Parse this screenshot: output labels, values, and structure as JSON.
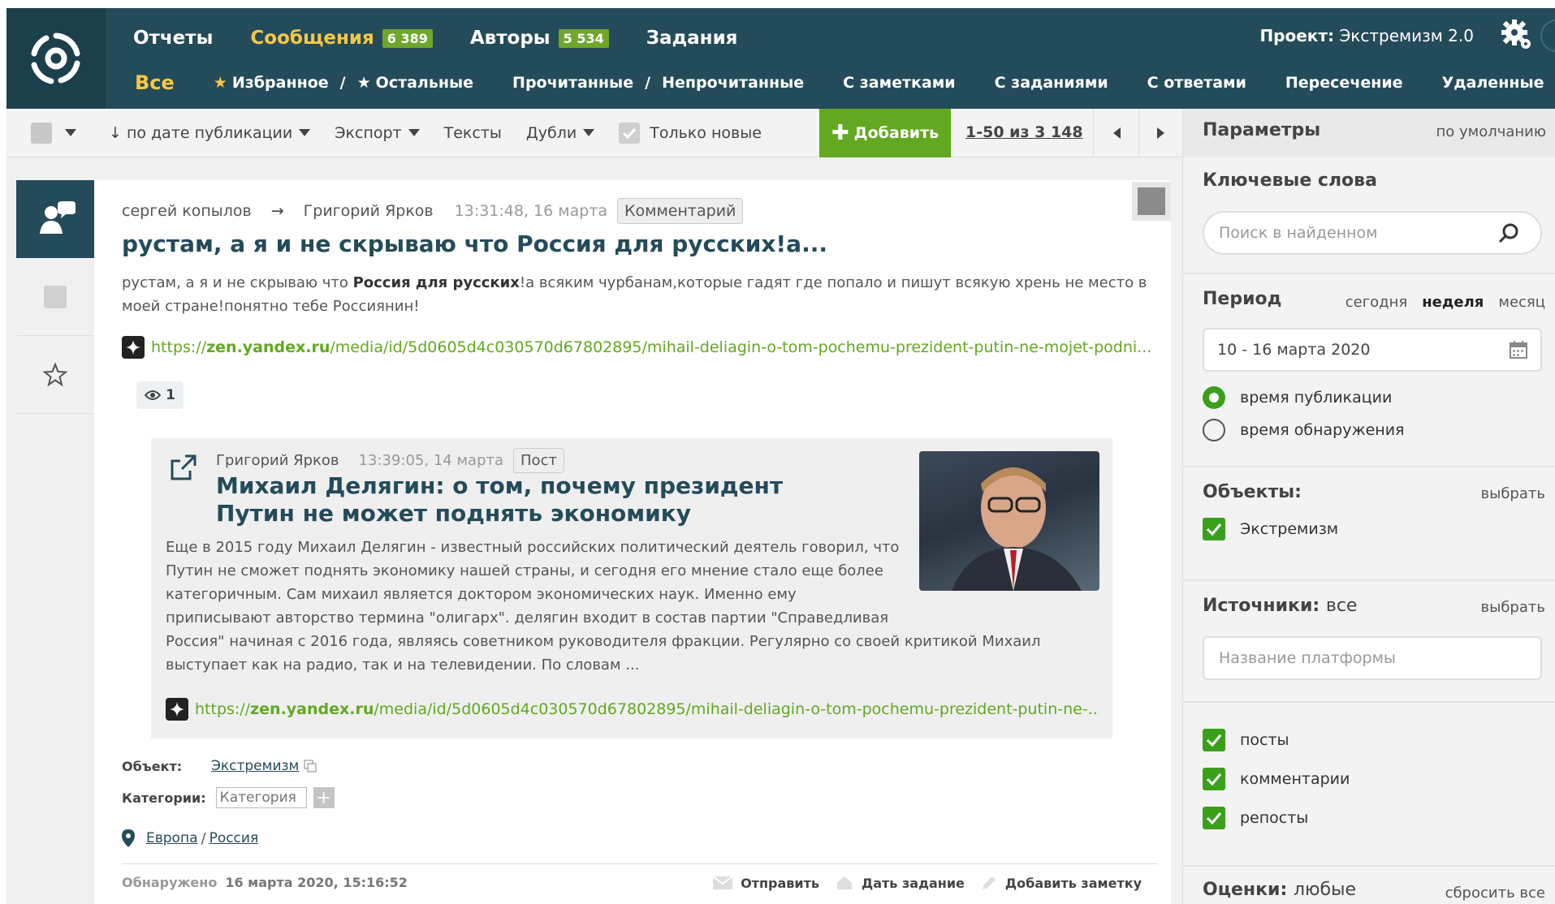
{
  "header": {
    "nav": [
      {
        "label": "Отчеты",
        "badge": null,
        "active": false
      },
      {
        "label": "Сообщения",
        "badge": "6 389",
        "active": true
      },
      {
        "label": "Авторы",
        "badge": "5 534",
        "active": false
      },
      {
        "label": "Задания",
        "badge": null,
        "active": false
      }
    ],
    "project_label": "Проект:",
    "project_name": "Экстремизм 2.0",
    "filters": {
      "all": "Все",
      "favorites": "Избранное",
      "others": "Остальные",
      "read": "Прочитанные",
      "unread": "Непрочитанные",
      "with_notes": "С заметками",
      "with_tasks": "С заданиями",
      "with_replies": "С ответами",
      "intersection": "Пересечение",
      "deleted": "Удаленные",
      "sep": "/"
    }
  },
  "toolbar": {
    "sort": "↓ по дате публикации",
    "export": "Экспорт",
    "texts": "Тексты",
    "dupes": "Дубли",
    "only_new": "Только новые",
    "add": "Добавить",
    "pager": "1-50 из 3 148"
  },
  "post": {
    "author_from": "сергей копылов",
    "arrow": "→",
    "author_to": "Григорий Ярков",
    "time": "13:31:48, 16 марта",
    "type": "Комментарий",
    "title": "рустам, а я и не скрываю что Россия для русских!а...",
    "text_before": "рустам, а я и не скрываю что ",
    "text_bold": "Россия для русских",
    "text_after": "!а всяким чурбанам,которые гадят где попало и пишут всякую хрень не место в моей стране!понятно тебе Россиянин!",
    "link_prefix": "https://",
    "link_domain": "zen.yandex.ru",
    "link_path": "/media/id/5d0605d4c030570d67802895/mihail-deliagin-o-tom-pochemu-prezident-putin-ne-mojet-podni...",
    "views": "1",
    "quote": {
      "author": "Григорий Ярков",
      "time": "13:39:05, 14 марта",
      "type": "Пост",
      "title": "Михаил Делягин: о том, почему президент Путин не может поднять экономику",
      "text_1": "Еще в 2015 году Михаил Делягин - известный российских политический деятель говорил, что Путин не сможет поднять экономику нашей страны, и сегодня его мнение стало еще более категоричным. Сам михаил является доктором экономических наук. Именно ему приписывают авторство термина \"олигарх\". делягин входит в состав партии \"Справедливая",
      "text_2": "Россия\" начиная с 2016 года, являясь советником руководителя фракции. Регулярно со своей критикой Михаил выступает как на радио, так и на телевидении. По словам ...",
      "link_prefix": "https://",
      "link_domain": "zen.yandex.ru",
      "link_path": "/media/id/5d0605d4c030570d67802895/mihail-deliagin-o-tom-pochemu-prezident-putin-ne-..."
    },
    "object_label": "Объект:",
    "object_value": "Экстремизм",
    "categories_label": "Категории:",
    "category_placeholder": "Категория",
    "geo_region": "Европа",
    "geo_sep": "/",
    "geo_country": "Россия",
    "detected_label": "Обнаружено",
    "detected_value": "16 марта 2020, 15:16:52",
    "actions": {
      "send": "Отправить",
      "task": "Дать задание",
      "note": "Добавить заметку"
    }
  },
  "panel": {
    "title": "Параметры",
    "default": "по умолчанию",
    "keywords_title": "Ключевые слова",
    "keywords_placeholder": "Поиск в найденном",
    "period_title": "Период",
    "period_today": "сегодня",
    "period_week": "неделя",
    "period_month": "месяц",
    "period_value": "10 - 16 марта 2020",
    "radio_publish": "время публикации",
    "radio_detect": "время обнаружения",
    "objects_title": "Объекты:",
    "objects_select": "выбрать",
    "objects_item": "Экстремизм",
    "sources_title": "Источники:",
    "sources_value": "все",
    "sources_select": "выбрать",
    "platform_placeholder": "Название платформы",
    "types": [
      "посты",
      "комментарии",
      "репосты"
    ],
    "ratings_title": "Оценки:",
    "ratings_value": "любые",
    "reset_all": "сбросить все"
  },
  "colors": {
    "header_bg": "#244b5a",
    "accent_yellow": "#f7c844",
    "accent_green": "#62a821",
    "check_green": "#3aa01b"
  }
}
